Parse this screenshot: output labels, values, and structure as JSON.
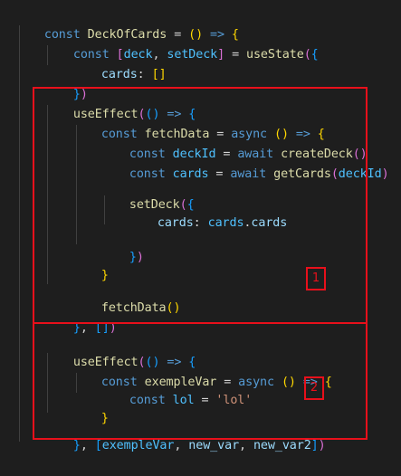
{
  "code": {
    "l1": {
      "a": "const ",
      "b": "DeckOfCards",
      "c": " = ",
      "d": "()",
      "e": " => ",
      "f": "{"
    },
    "l2": {
      "a": "const ",
      "b": "[",
      "c": "deck",
      "d": ", ",
      "e": "setDeck",
      "f": "]",
      "g": " = ",
      "h": "useState",
      "i": "(",
      "j": "{"
    },
    "l3": {
      "a": "cards",
      "b": ": ",
      "c": "[]"
    },
    "l4": {
      "a": "}",
      "b": ")"
    },
    "l5": {
      "a": "useEffect",
      "b": "(",
      "c": "()",
      "d": " => ",
      "e": "{"
    },
    "l6": {
      "a": "const ",
      "b": "fetchData",
      "c": " = ",
      "d": "async ",
      "e": "()",
      "f": " => ",
      "g": "{"
    },
    "l7": {
      "a": "const ",
      "b": "deckId",
      "c": " = ",
      "d": "await ",
      "e": "createDeck",
      "f": "()"
    },
    "l8": {
      "a": "const ",
      "b": "cards",
      "c": " = ",
      "d": "await ",
      "e": "getCards",
      "f": "(",
      "g": "deckId",
      "h": ")"
    },
    "l9": {
      "a": "setDeck",
      "b": "(",
      "c": "{"
    },
    "l10": {
      "a": "cards",
      "b": ": ",
      "c": "cards",
      "d": ".",
      "e": "cards"
    },
    "l11": {
      "a": "}",
      "b": ")"
    },
    "l12": {
      "a": "}"
    },
    "l13": {
      "a": "fetchData",
      "b": "()"
    },
    "l14": {
      "a": "}",
      "b": ", ",
      "c": "[]",
      "d": ")"
    },
    "l15": {
      "a": "useEffect",
      "b": "(",
      "c": "()",
      "d": " => ",
      "e": "{"
    },
    "l16": {
      "a": "const ",
      "b": "exempleVar",
      "c": " = ",
      "d": "async ",
      "e": "()",
      "f": " => ",
      "g": "{"
    },
    "l17": {
      "a": "const ",
      "b": "lol",
      "c": " = ",
      "d": "'lol'"
    },
    "l18": {
      "a": "}"
    },
    "l19": {
      "a": "}",
      "b": ", ",
      "c": "[",
      "d": "exempleVar",
      "e": ", ",
      "f": "new_var",
      "g": ", ",
      "h": "new_var2",
      "i": "]",
      "j": ")"
    }
  },
  "annotations": {
    "box1_label": "1",
    "box2_label": "2",
    "color": "#e8101b"
  }
}
